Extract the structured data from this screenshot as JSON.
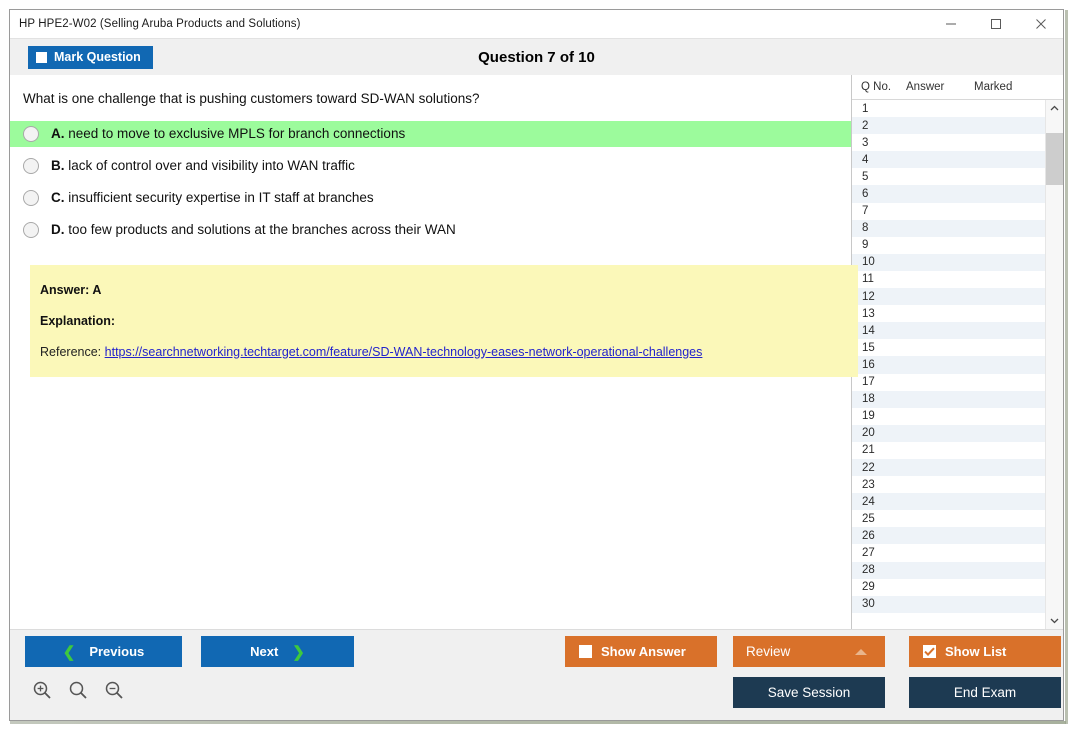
{
  "window": {
    "title": "HP HPE2-W02 (Selling Aruba Products and Solutions)",
    "minimize_icon": "minimize-icon",
    "maximize_icon": "maximize-icon",
    "close_icon": "close-icon"
  },
  "toolbar": {
    "mark_question_label": "Mark Question",
    "mark_question_checked": false,
    "question_counter": "Question 7 of 10"
  },
  "question": {
    "text": "What is one challenge that is pushing customers toward SD-WAN solutions?",
    "options": [
      {
        "letter": "A.",
        "text": "need to move to exclusive MPLS for branch connections",
        "correct": true
      },
      {
        "letter": "B.",
        "text": "lack of control over and visibility into WAN traffic",
        "correct": false
      },
      {
        "letter": "C.",
        "text": "insufficient security expertise in IT staff at branches",
        "correct": false
      },
      {
        "letter": "D.",
        "text": "too few products and solutions at the branches across their WAN",
        "correct": false
      }
    ]
  },
  "answer_panel": {
    "answer_label": "Answer: A",
    "explanation_label": "Explanation:",
    "reference_prefix": "Reference:",
    "reference_url": "https://searchnetworking.techtarget.com/feature/SD-WAN-technology-eases-network-operational-challenges"
  },
  "question_list": {
    "columns": [
      "Q No.",
      "Answer",
      "Marked"
    ],
    "rows": [
      {
        "qno": "1",
        "answer": "",
        "marked": ""
      },
      {
        "qno": "2",
        "answer": "",
        "marked": ""
      },
      {
        "qno": "3",
        "answer": "",
        "marked": ""
      },
      {
        "qno": "4",
        "answer": "",
        "marked": ""
      },
      {
        "qno": "5",
        "answer": "",
        "marked": ""
      },
      {
        "qno": "6",
        "answer": "",
        "marked": ""
      },
      {
        "qno": "7",
        "answer": "",
        "marked": ""
      },
      {
        "qno": "8",
        "answer": "",
        "marked": ""
      },
      {
        "qno": "9",
        "answer": "",
        "marked": ""
      },
      {
        "qno": "10",
        "answer": "",
        "marked": ""
      },
      {
        "qno": "11",
        "answer": "",
        "marked": ""
      },
      {
        "qno": "12",
        "answer": "",
        "marked": ""
      },
      {
        "qno": "13",
        "answer": "",
        "marked": ""
      },
      {
        "qno": "14",
        "answer": "",
        "marked": ""
      },
      {
        "qno": "15",
        "answer": "",
        "marked": ""
      },
      {
        "qno": "16",
        "answer": "",
        "marked": ""
      },
      {
        "qno": "17",
        "answer": "",
        "marked": ""
      },
      {
        "qno": "18",
        "answer": "",
        "marked": ""
      },
      {
        "qno": "19",
        "answer": "",
        "marked": ""
      },
      {
        "qno": "20",
        "answer": "",
        "marked": ""
      },
      {
        "qno": "21",
        "answer": "",
        "marked": ""
      },
      {
        "qno": "22",
        "answer": "",
        "marked": ""
      },
      {
        "qno": "23",
        "answer": "",
        "marked": ""
      },
      {
        "qno": "24",
        "answer": "",
        "marked": ""
      },
      {
        "qno": "25",
        "answer": "",
        "marked": ""
      },
      {
        "qno": "26",
        "answer": "",
        "marked": ""
      },
      {
        "qno": "27",
        "answer": "",
        "marked": ""
      },
      {
        "qno": "28",
        "answer": "",
        "marked": ""
      },
      {
        "qno": "29",
        "answer": "",
        "marked": ""
      },
      {
        "qno": "30",
        "answer": "",
        "marked": ""
      }
    ]
  },
  "footer": {
    "previous_label": "Previous",
    "next_label": "Next",
    "show_answer_label": "Show Answer",
    "show_answer_checked": false,
    "review_label": "Review",
    "show_list_label": "Show List",
    "show_list_checked": true,
    "save_session_label": "Save Session",
    "end_exam_label": "End Exam",
    "zoom_in_icon": "zoom-in-icon",
    "zoom_reset_icon": "zoom-reset-icon",
    "zoom_out_icon": "zoom-out-icon"
  },
  "colors": {
    "accent_blue": "#1168b3",
    "accent_orange": "#d9712a",
    "navy": "#1d3a52",
    "correct_green": "#9cfb9c",
    "answer_yellow": "#fbf8b9",
    "link_blue": "#2222cc"
  }
}
